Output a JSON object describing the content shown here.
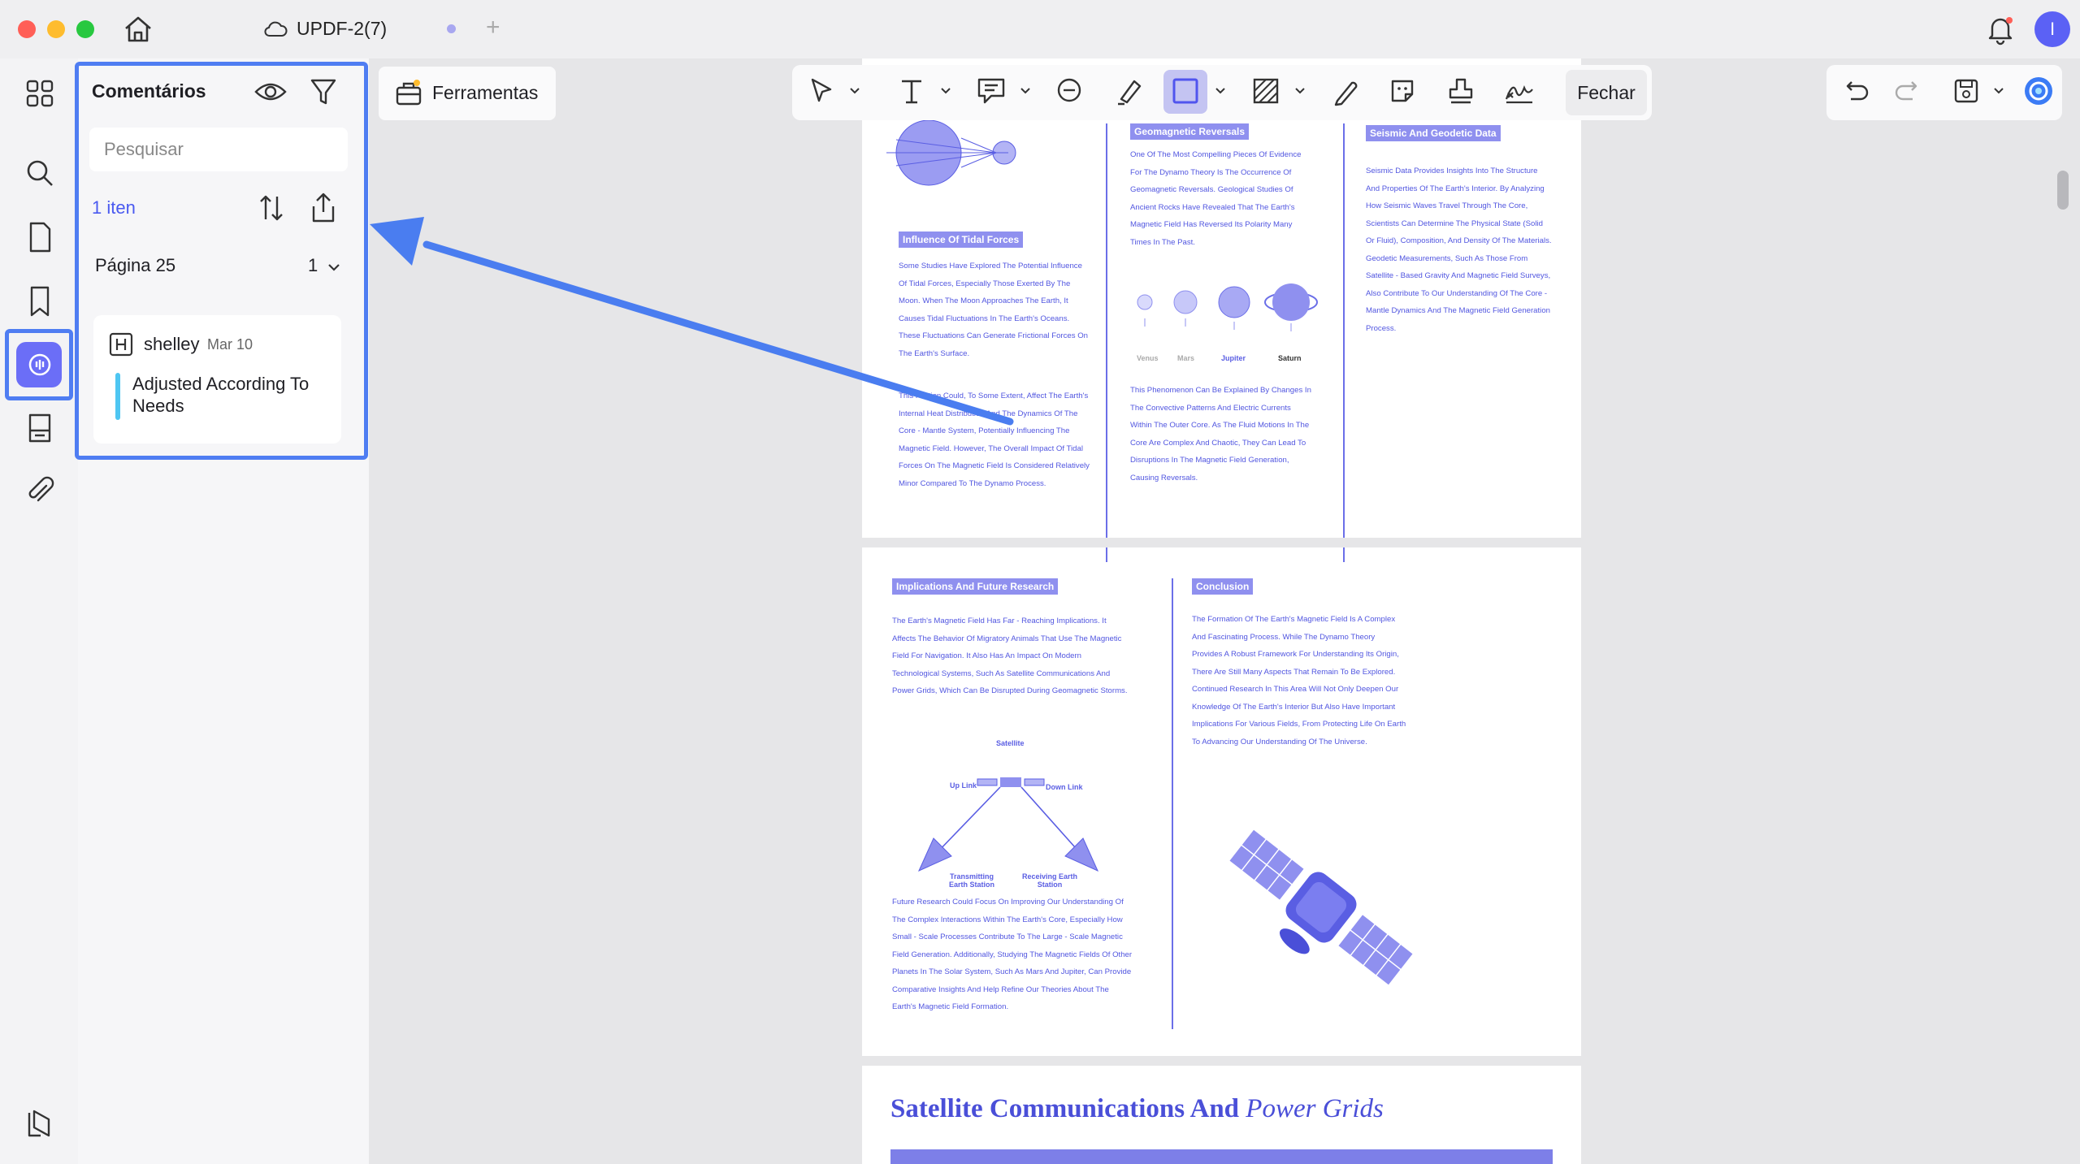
{
  "window": {
    "title": "UPDF-2(7)",
    "new_tab": "+",
    "avatar_letter": "I",
    "traffic_lights": [
      "#ff5f57",
      "#febc2e",
      "#28c840"
    ]
  },
  "left_nav": {
    "items": [
      "apps-icon",
      "search-icon",
      "pages-icon",
      "bookmark-icon",
      "comments-icon",
      "form-icon",
      "attachment-icon"
    ],
    "bottom": "layers-icon"
  },
  "comments_panel": {
    "title": "Comentários",
    "search_placeholder": "Pesquisar",
    "count": "1 iten",
    "page_label": "Página 25",
    "page_count": "1",
    "comment": {
      "author": "shelley",
      "date": "Mar 10",
      "text": "Adjusted According To Needs",
      "color": "#4ec6f2"
    }
  },
  "toolbar": {
    "tools_label": "Ferramentas",
    "close_label": "Fechar",
    "tools": [
      "select-icon",
      "text-icon",
      "callout-icon",
      "comment-icon",
      "highlighter-icon",
      "rectangle-icon",
      "hatch-icon",
      "pencil-icon",
      "sticker-icon",
      "stamp-icon",
      "signature-icon"
    ],
    "active_tool": "rectangle-icon",
    "right": [
      "undo-icon",
      "redo-icon",
      "save-icon",
      "ai-assistant-icon"
    ]
  },
  "accent_color": "#4f7df2",
  "document": {
    "page1": {
      "tidal_heading": "Influence Of Tidal Forces",
      "tidal_text": "Some Studies Have Explored The Potential Influence Of Tidal Forces, Especially Those Exerted By The Moon. When The Moon Approaches The Earth, It Causes Tidal Fluctuations In The Earth's Oceans. These Fluctuations Can Generate Frictional Forces On The Earth's Surface.",
      "tidal_text2": "This Friction Could, To Some Extent, Affect The Earth's Internal Heat Distribution And The Dynamics Of The Core - Mantle System, Potentially Influencing The Magnetic Field. However, The Overall Impact Of Tidal Forces On The Magnetic Field Is Considered Relatively Minor Compared To The Dynamo Process.",
      "reversals_heading": "Geomagnetic Reversals",
      "reversals_text": "One Of The Most Compelling Pieces Of Evidence For The Dynamo Theory Is The Occurrence Of Geomagnetic Reversals. Geological Studies Of Ancient Rocks Have Revealed That The Earth's Magnetic Field Has Reversed Its Polarity Many Times In The Past.",
      "planets": [
        "Venus",
        "Mars",
        "Jupiter",
        "Saturn"
      ],
      "reversals_text2": "This Phenomenon Can Be Explained By Changes In The Convective Patterns And Electric Currents Within The Outer Core. As The Fluid Motions In The Core Are Complex And Chaotic, They Can Lead To Disruptions In The Magnetic Field Generation, Causing Reversals.",
      "seismic_heading": "Seismic And Geodetic Data",
      "seismic_text": "Seismic Data Provides Insights Into The Structure And Properties Of The Earth's Interior. By Analyzing How Seismic Waves Travel Through The Core, Scientists Can Determine The Physical State (Solid Or Fluid), Composition, And Density Of The Materials. Geodetic Measurements, Such As Those From Satellite - Based Gravity And Magnetic Field Surveys, Also Contribute To Our Understanding Of The Core - Mantle Dynamics And The Magnetic Field Generation Process."
    },
    "page2": {
      "implications_heading": "Implications And Future Research",
      "implications_text": "The Earth's Magnetic Field Has Far - Reaching Implications. It Affects The Behavior Of Migratory Animals That Use The Magnetic Field For Navigation. It Also Has An Impact On Modern Technological Systems, Such As Satellite Communications And Power Grids, Which Can Be Disrupted During Geomagnetic Storms.",
      "diagram_labels": {
        "satellite": "Satellite",
        "up_link": "Up Link",
        "down_link": "Down Link",
        "transmitting": "Transmitting Earth Station",
        "receiving": "Receiving Earth Station"
      },
      "future_text": "Future Research Could Focus On Improving Our Understanding Of The Complex Interactions Within The Earth's Core, Especially How Small - Scale Processes Contribute To The Large - Scale Magnetic Field Generation. Additionally, Studying The Magnetic Fields Of Other Planets In The Solar System, Such As Mars And Jupiter, Can Provide Comparative Insights And Help Refine Our Theories About The Earth's Magnetic Field Formation.",
      "conclusion_heading": "Conclusion",
      "conclusion_text": "The Formation Of The Earth's Magnetic Field Is A Complex And Fascinating Process. While The Dynamo Theory Provides A Robust Framework For Understanding Its Origin, There Are Still Many Aspects That Remain To Be Explored. Continued Research In This Area Will Not Only Deepen Our Knowledge Of The Earth's Interior But Also Have Important Implications For Various Fields, From Protecting Life On Earth To Advancing Our Understanding Of The Universe."
    },
    "page3": {
      "heading_bold": "Satellite Communications And",
      "heading_italic": "Power Grids"
    }
  }
}
